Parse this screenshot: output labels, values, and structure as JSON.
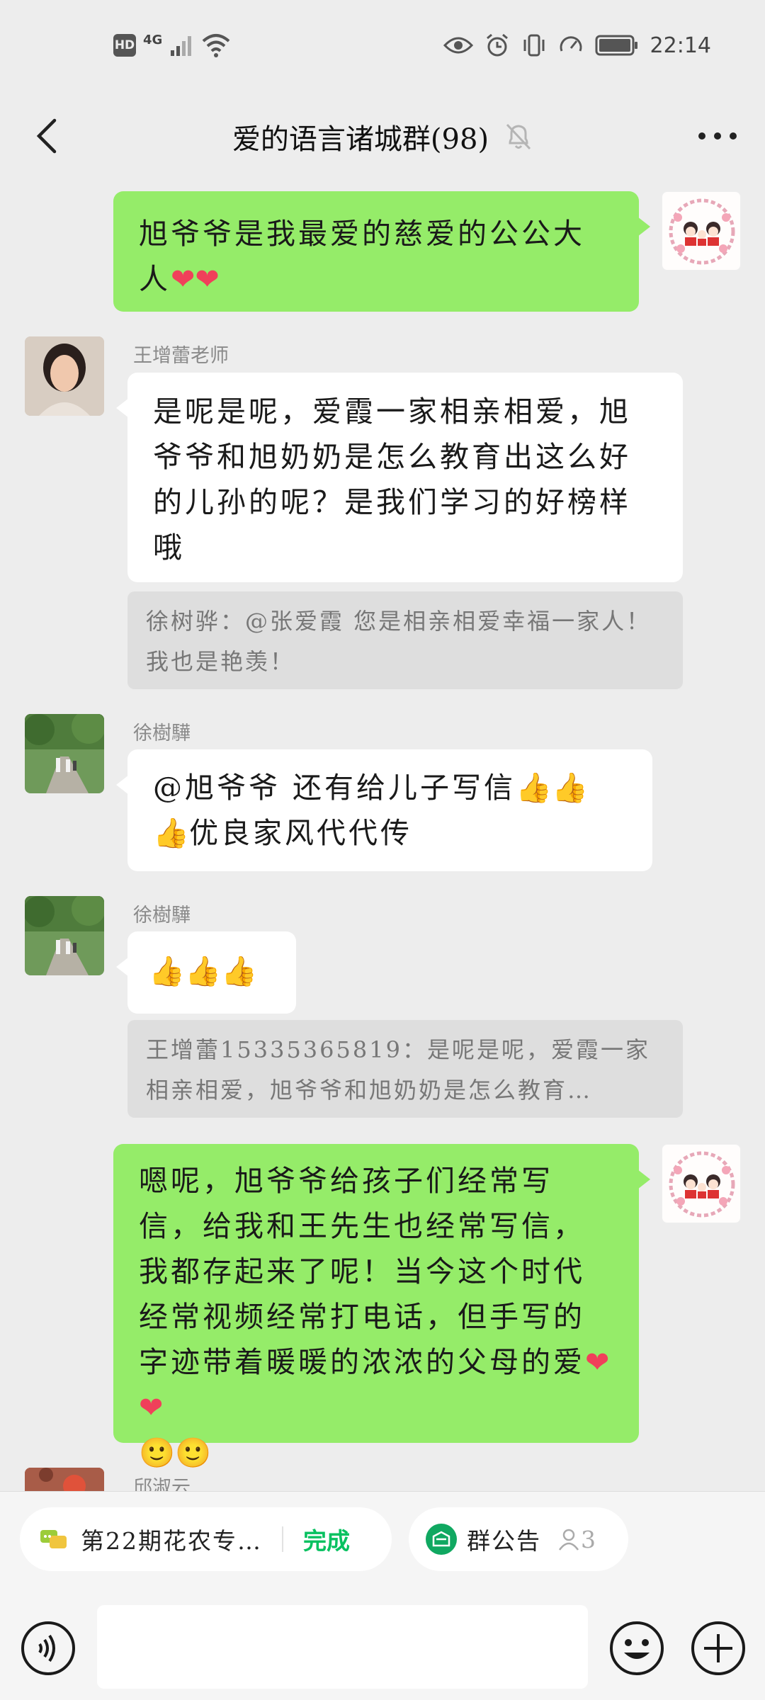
{
  "status_bar": {
    "hd": "HD",
    "network": "4G",
    "time": "22:14"
  },
  "header": {
    "title": "爱的语言诸城群(98)"
  },
  "messages": [
    {
      "sender": "",
      "text": "旭爷爷是我最爱的慈爱的公公大人",
      "emoji": "❤❤"
    },
    {
      "sender": "王增蕾老师",
      "text": "是呢是呢，爱霞一家相亲相爱，旭爷爷和旭奶奶是怎么教育出这么好的儿孙的呢？是我们学习的好榜样哦",
      "quote": "徐树骅：@张爱霞 您是相亲相爱幸福一家人！我也是艳羡！"
    },
    {
      "sender": "徐樹驊",
      "text_a": "@旭爷爷  还有给儿子写信",
      "emoji_a": "👍👍",
      "emoji_b": "👍",
      "text_b": "优良家风代代传"
    },
    {
      "sender": "徐樹驊",
      "emoji": "👍👍👍",
      "quote": "王增蕾15335365819：是呢是呢，爱霞一家相亲相爱，旭爷爷和旭奶奶是怎么教育…"
    },
    {
      "sender": "",
      "text": "嗯呢，旭爷爷给孩子们经常写信，给我和王先生也经常写信，我都存起来了呢！当今这个时代经常视频经常打电话，但手写的字迹带着暖暖的浓浓的父母的爱",
      "emoji": "❤❤",
      "emoji_b": "🙂🙂"
    },
    {
      "sender": "邱淑云"
    }
  ],
  "bottom": {
    "pill_left_text": "第22期花农专…",
    "pill_left_done": "完成",
    "pill_right_text": "群公告",
    "pill_right_count": "3"
  },
  "colors": {
    "bubble_green": "#95ec69",
    "bubble_white": "#ffffff",
    "background": "#ededed",
    "accent_green": "#07c160"
  }
}
